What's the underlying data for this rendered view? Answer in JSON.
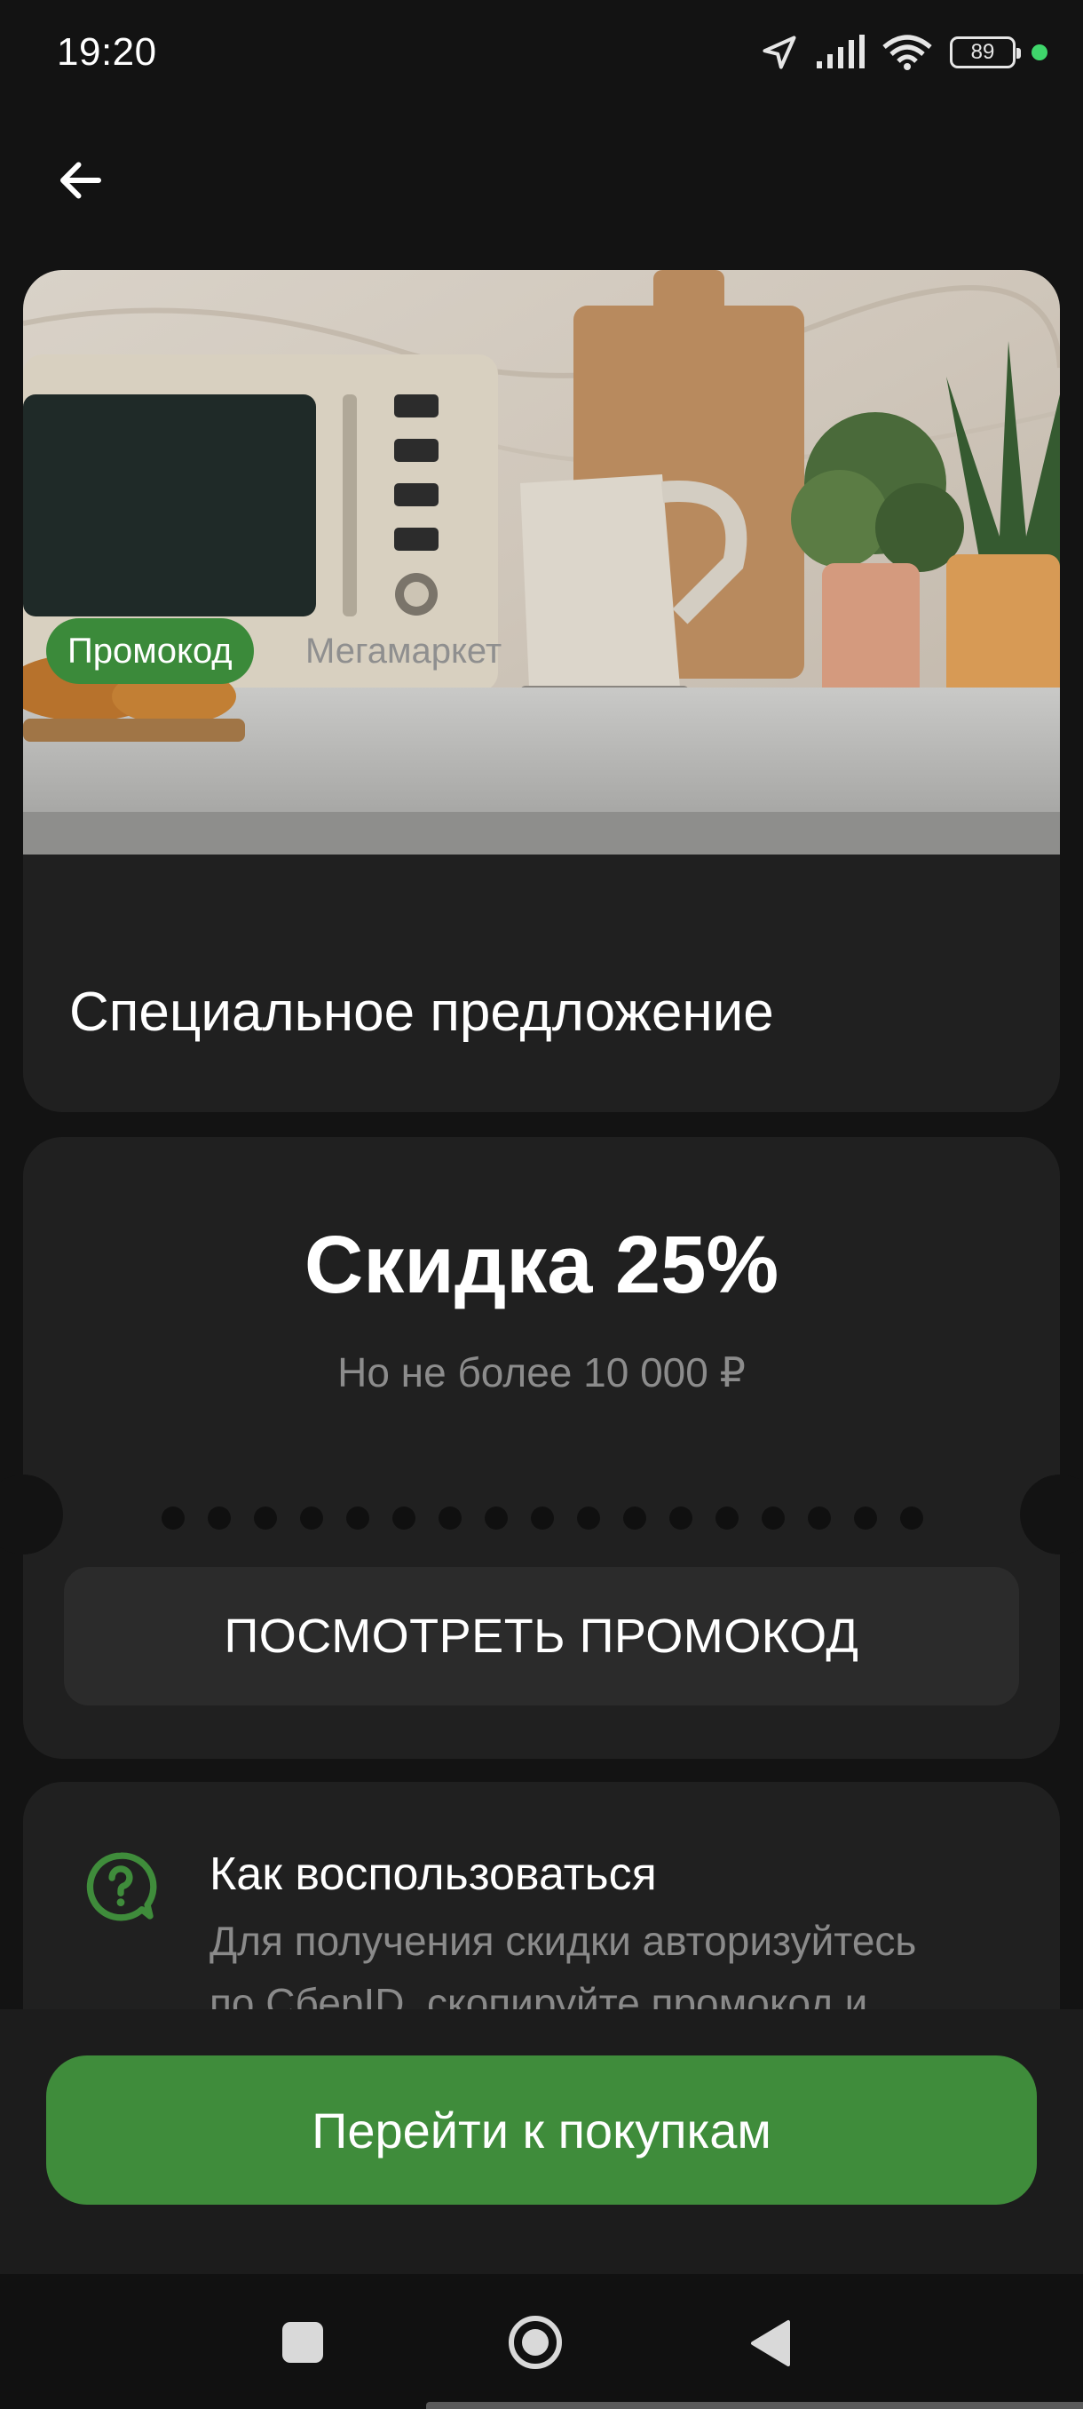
{
  "status_bar": {
    "time": "19:20",
    "battery": "89"
  },
  "hero": {
    "tag": "Промокод",
    "brand": "Мегамаркет",
    "title": "Специальное предложение"
  },
  "discount": {
    "title": "Скидка 25%",
    "subtitle": "Но не более 10 000 ₽",
    "button": "ПОСМОТРЕТЬ ПРОМОКОД"
  },
  "howto": {
    "title": "Как воспользоваться",
    "text_line1": "Для получения скидки авторизуйтесь",
    "text_line2": "по СберID, скопируйте промокод и"
  },
  "cta": {
    "label": "Перейти к покупкам"
  },
  "colors": {
    "accent": "#3f8c3b",
    "card": "#202020",
    "background": "#131313"
  },
  "icons": [
    "navigation-arrow-icon",
    "signal-icon",
    "wifi-icon",
    "battery-icon",
    "back-arrow-icon",
    "question-bubble-icon",
    "nav-square-icon",
    "nav-circle-icon",
    "nav-triangle-icon"
  ]
}
